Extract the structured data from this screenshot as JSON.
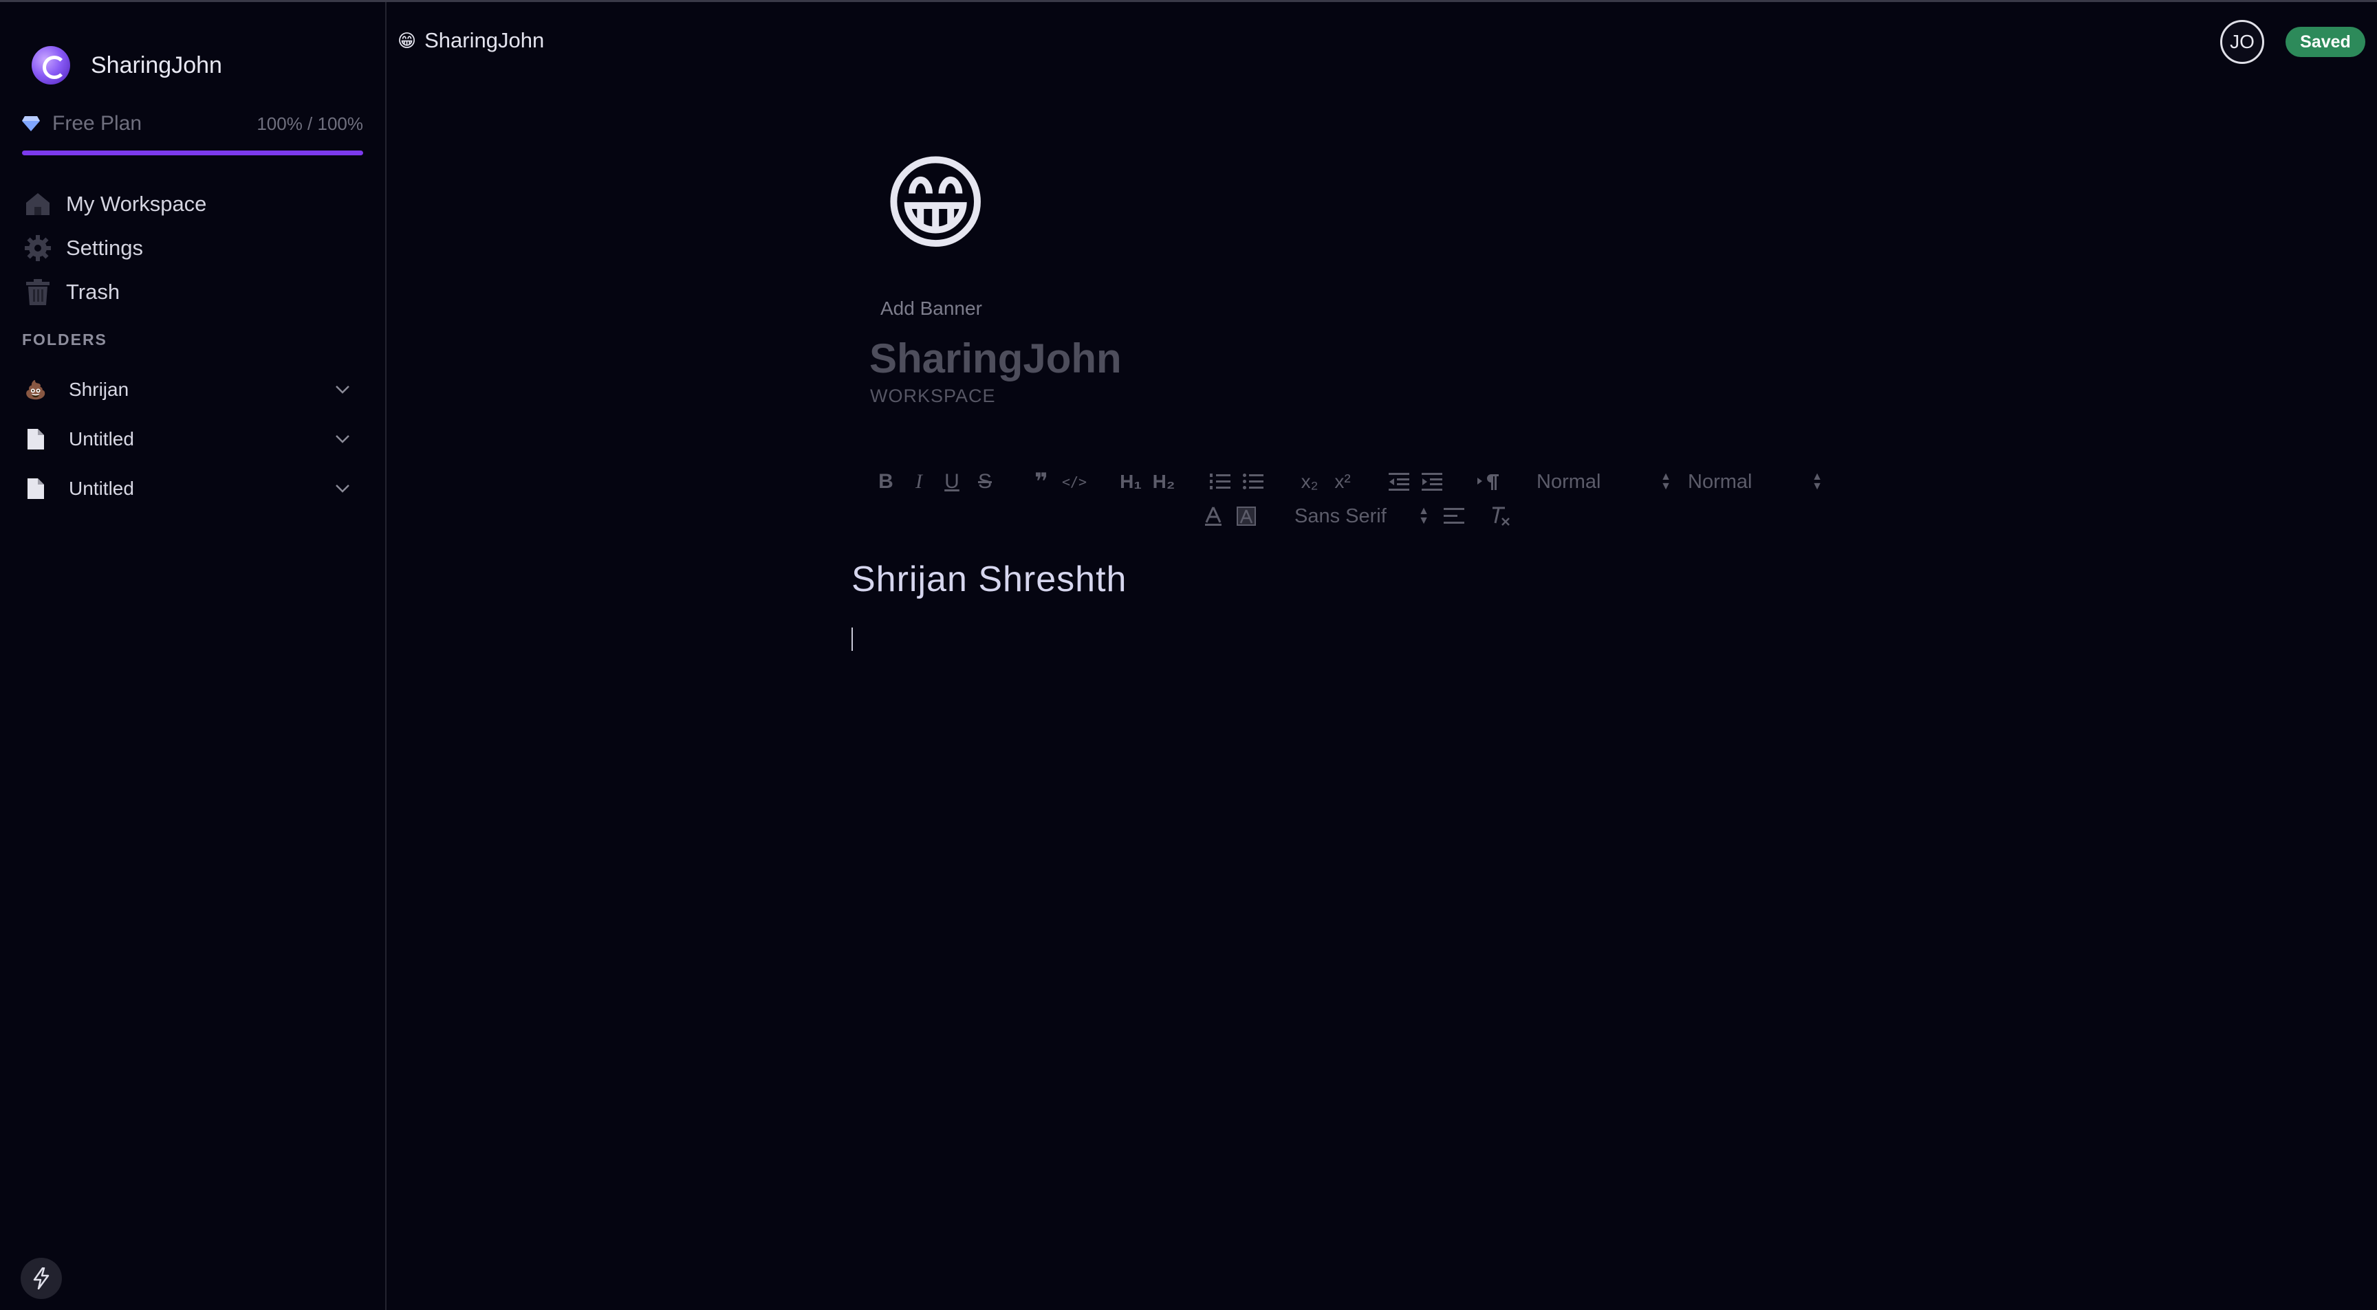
{
  "sidebar": {
    "workspace_name": "SharingJohn",
    "plan": {
      "label": "Free Plan",
      "usage": "100% / 100%",
      "usage_fraction": 1.0
    },
    "nav": [
      {
        "label": "My Workspace",
        "icon": "home-icon"
      },
      {
        "label": "Settings",
        "icon": "gear-icon"
      },
      {
        "label": "Trash",
        "icon": "trash-icon"
      }
    ],
    "folders_title": "FOLDERS",
    "folders": [
      {
        "label": "Shrijan",
        "icon": "emoji-icon"
      },
      {
        "label": "Untitled",
        "icon": "file-icon"
      },
      {
        "label": "Untitled",
        "icon": "file-icon"
      }
    ]
  },
  "header": {
    "breadcrumb_emoji": "😁",
    "breadcrumb_text": "SharingJohn",
    "avatar_initials": "JO",
    "save_status": "Saved"
  },
  "document": {
    "emoji": "😁",
    "add_banner_label": "Add Banner",
    "title": "SharingJohn",
    "subtitle": "WORKSPACE"
  },
  "toolbar": {
    "bold": "B",
    "italic": "I",
    "underline": "U",
    "strike": "S",
    "blockquote": "❞",
    "code": "</>",
    "h1": "H₁",
    "h2": "H₂",
    "subscript": "x₂",
    "superscript": "x²",
    "header_select": "Normal",
    "size_select": "Normal",
    "font_select": "Sans Serif"
  },
  "editor": {
    "content_heading": "Shrijan  Shreshth"
  },
  "colors": {
    "accent": "#7c3aed",
    "saved_badge": "#2d8a5a",
    "background": "#050511"
  }
}
